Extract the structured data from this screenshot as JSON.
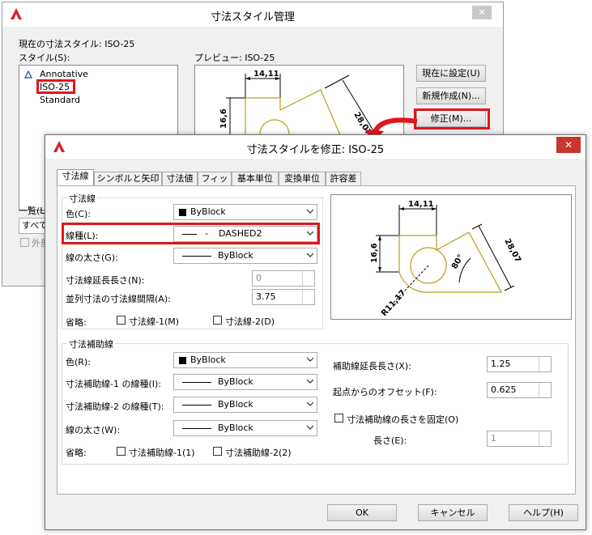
{
  "back": {
    "title": "寸法スタイル管理",
    "close": "✕",
    "current_style": "現在の寸法スタイル: ISO-25",
    "styles_label": "スタイル(S):",
    "styles": [
      "Annotative",
      "ISO-25",
      "Standard"
    ],
    "preview_label": "プレビュー: ISO-25",
    "set_current": "現在に設定(U)",
    "new": "新規作成(N)...",
    "modify": "修正(M)...",
    "list_label": "一覧(L)",
    "list_value": "すべて",
    "xref_label": "外部"
  },
  "front": {
    "title": "寸法スタイルを修正: ISO-25",
    "close": "✕",
    "tabs": [
      "寸法線",
      "シンボルと矢印",
      "寸法値",
      "フィット",
      "基本単位",
      "変換単位",
      "許容差"
    ],
    "dim_lines": {
      "title": "寸法線",
      "color_label": "色(C):",
      "color_value": "ByBlock",
      "linetype_label": "線種(L):",
      "linetype_value": "DASHED2",
      "lineweight_label": "線の太さ(G):",
      "lineweight_value": "ByBlock",
      "extend_label": "寸法線延長長さ(N):",
      "extend_value": "0",
      "baseline_label": "並列寸法の寸法線間隔(A):",
      "baseline_value": "3.75",
      "suppress_label": "省略:",
      "suppress1": "寸法線-1(M)",
      "suppress2": "寸法線-2(D)"
    },
    "ext_lines": {
      "title": "寸法補助線",
      "color_label": "色(R):",
      "color_value": "ByBlock",
      "lt1_label": "寸法補助線-1 の線種(I):",
      "lt1_value": "ByBlock",
      "lt2_label": "寸法補助線-2 の線種(T):",
      "lt2_value": "ByBlock",
      "lw_label": "線の太さ(W):",
      "lw_value": "ByBlock",
      "suppress_label": "省略:",
      "suppress1": "寸法補助線-1(1)",
      "suppress2": "寸法補助線-2(2)",
      "beyond_label": "補助線延長長さ(X):",
      "beyond_value": "1.25",
      "offset_label": "起点からのオフセット(F):",
      "offset_value": "0.625",
      "fixed_label": "寸法補助線の長さを固定(O)",
      "length_label": "長さ(E):",
      "length_value": "1"
    },
    "preview": {
      "d1": "14,11",
      "d2": "16,6",
      "d3": "28,07",
      "angle": "80°",
      "radius": "R11,17"
    },
    "ok": "OK",
    "cancel": "キャンセル",
    "help": "ヘルプ(H)"
  },
  "colors": {
    "highlight": "#e4141b",
    "shape": "#b8a21e",
    "selected": "#3399ff"
  }
}
